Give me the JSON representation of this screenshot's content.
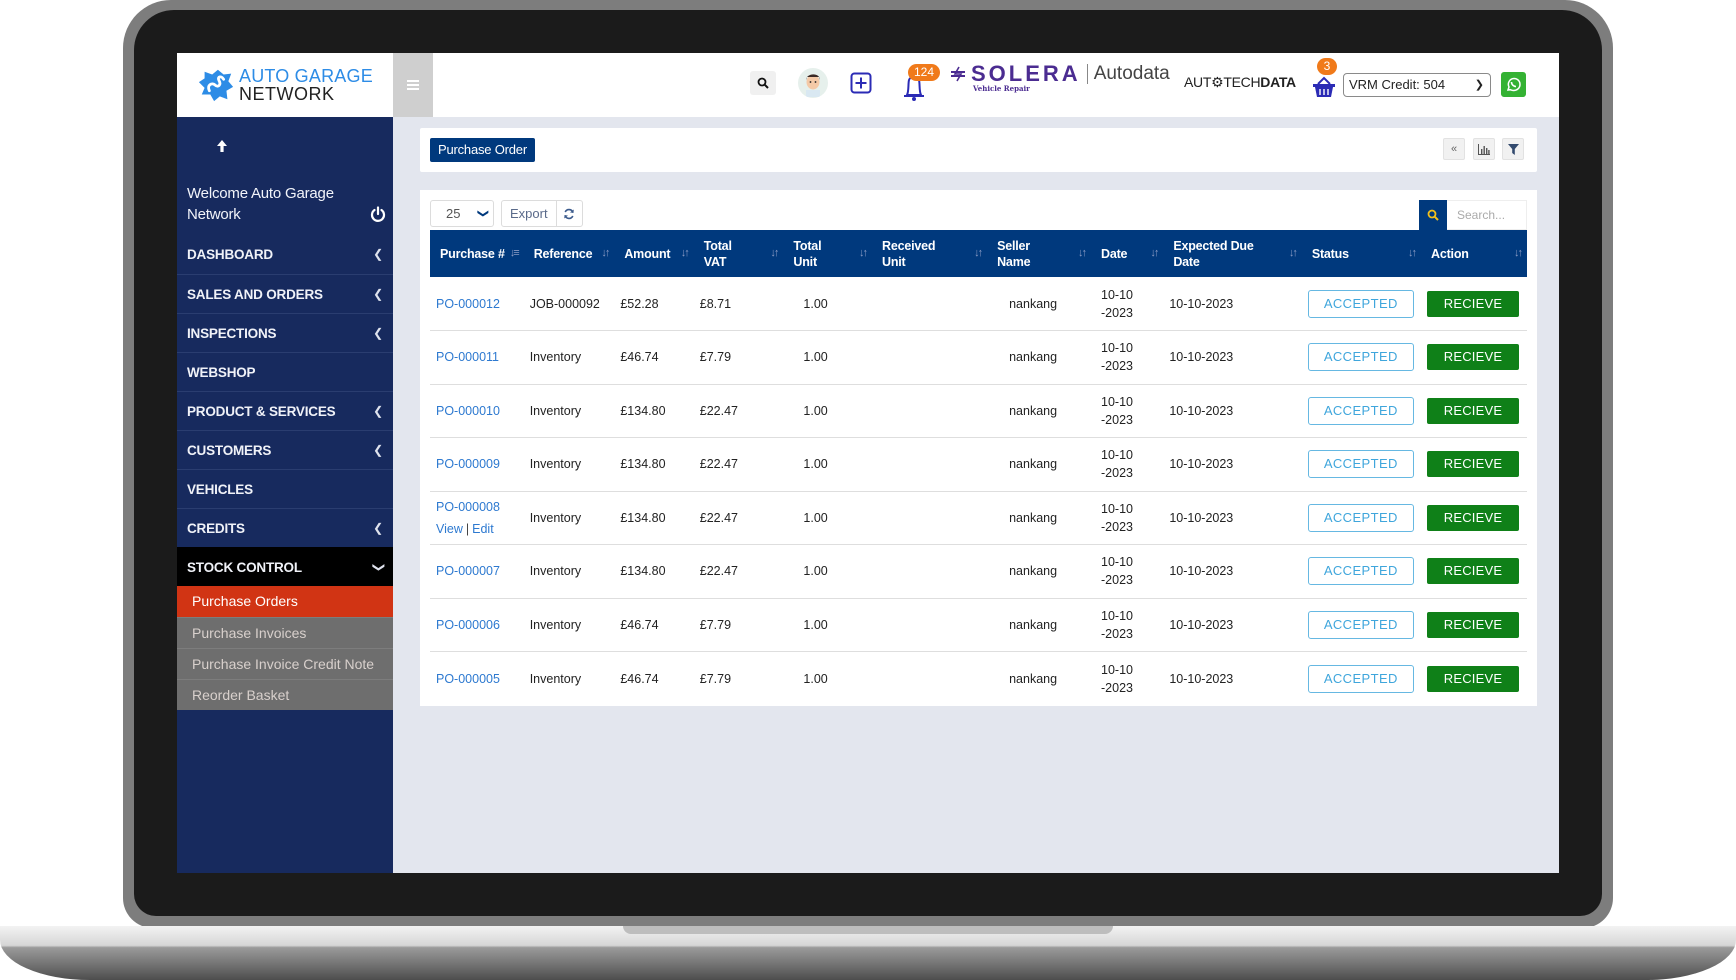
{
  "header": {
    "logo_line1": "AUTO GARAGE",
    "logo_line2": "NETWORK",
    "notification_count": "124",
    "partner_solera": "SOLERA",
    "partner_solera_sub": "Vehicle Repair",
    "partner_autodata": "Autodata",
    "partner_atd_light": "AUT⚙TECH",
    "partner_atd_bold": "DATA",
    "basket_count": "3",
    "vrm_credit": "VRM Credit: 504"
  },
  "sidebar": {
    "welcome": "Welcome Auto Garage Network",
    "items": [
      {
        "label": "DASHBOARD",
        "has_chevron": true
      },
      {
        "label": "SALES AND ORDERS",
        "has_chevron": true
      },
      {
        "label": "INSPECTIONS",
        "has_chevron": true
      },
      {
        "label": "WEBSHOP",
        "has_chevron": false
      },
      {
        "label": "PRODUCT & SERVICES",
        "has_chevron": true
      },
      {
        "label": "CUSTOMERS",
        "has_chevron": true
      },
      {
        "label": "VEHICLES",
        "has_chevron": false
      },
      {
        "label": "CREDITS",
        "has_chevron": true
      },
      {
        "label": "STOCK CONTROL",
        "has_chevron": true,
        "expanded": true
      }
    ],
    "submenu": [
      {
        "label": "Purchase Orders",
        "current": true
      },
      {
        "label": "Purchase Invoices"
      },
      {
        "label": "Purchase Invoice Credit Note"
      },
      {
        "label": "Reorder Basket"
      }
    ]
  },
  "page": {
    "title_button": "Purchase Order",
    "page_length": "25",
    "export_label": "Export",
    "search_placeholder": "Search..."
  },
  "table": {
    "columns": [
      "Purchase #",
      "Reference",
      "Amount",
      "Total VAT",
      "Total Unit",
      "Received Unit",
      "Seller Name",
      "Date",
      "Expected Due Date",
      "Status",
      "Action"
    ],
    "rows": [
      {
        "po": "PO-000012",
        "reference": "JOB-000092",
        "amount": "£52.28",
        "vat": "£8.71",
        "unit": "1.00",
        "received": "",
        "seller": "nankang",
        "date": "10-10-2023",
        "due": "10-10-2023",
        "status": "ACCEPTED",
        "action": "RECIEVE"
      },
      {
        "po": "PO-000011",
        "reference": "Inventory",
        "amount": "£46.74",
        "vat": "£7.79",
        "unit": "1.00",
        "received": "",
        "seller": "nankang",
        "date": "10-10-2023",
        "due": "10-10-2023",
        "status": "ACCEPTED",
        "action": "RECIEVE"
      },
      {
        "po": "PO-000010",
        "reference": "Inventory",
        "amount": "£134.80",
        "vat": "£22.47",
        "unit": "1.00",
        "received": "",
        "seller": "nankang",
        "date": "10-10-2023",
        "due": "10-10-2023",
        "status": "ACCEPTED",
        "action": "RECIEVE"
      },
      {
        "po": "PO-000009",
        "reference": "Inventory",
        "amount": "£134.80",
        "vat": "£22.47",
        "unit": "1.00",
        "received": "",
        "seller": "nankang",
        "date": "10-10-2023",
        "due": "10-10-2023",
        "status": "ACCEPTED",
        "action": "RECIEVE"
      },
      {
        "po": "PO-000008",
        "reference": "Inventory",
        "amount": "£134.80",
        "vat": "£22.47",
        "unit": "1.00",
        "received": "",
        "seller": "nankang",
        "date": "10-10-2023",
        "due": "10-10-2023",
        "status": "ACCEPTED",
        "action": "RECIEVE",
        "hover_links": {
          "view": "View",
          "sep": "|",
          "edit": "Edit"
        }
      },
      {
        "po": "PO-000007",
        "reference": "Inventory",
        "amount": "£134.80",
        "vat": "£22.47",
        "unit": "1.00",
        "received": "",
        "seller": "nankang",
        "date": "10-10-2023",
        "due": "10-10-2023",
        "status": "ACCEPTED",
        "action": "RECIEVE"
      },
      {
        "po": "PO-000006",
        "reference": "Inventory",
        "amount": "£46.74",
        "vat": "£7.79",
        "unit": "1.00",
        "received": "",
        "seller": "nankang",
        "date": "10-10-2023",
        "due": "10-10-2023",
        "status": "ACCEPTED",
        "action": "RECIEVE"
      },
      {
        "po": "PO-000005",
        "reference": "Inventory",
        "amount": "£46.74",
        "vat": "£7.79",
        "unit": "1.00",
        "received": "",
        "seller": "nankang",
        "date": "10-10-2023",
        "due": "10-10-2023",
        "status": "ACCEPTED",
        "action": "RECIEVE"
      }
    ]
  },
  "colors": {
    "sidebar_bg": "#172a5e",
    "brand_blue": "#00397d",
    "active_submenu": "#d13414",
    "recieve_green": "#0f8018",
    "accepted_border": "#66b8e2",
    "link_blue": "#2d79d0",
    "badge_orange": "#f07a1a",
    "whatsapp_green": "#34b233"
  }
}
